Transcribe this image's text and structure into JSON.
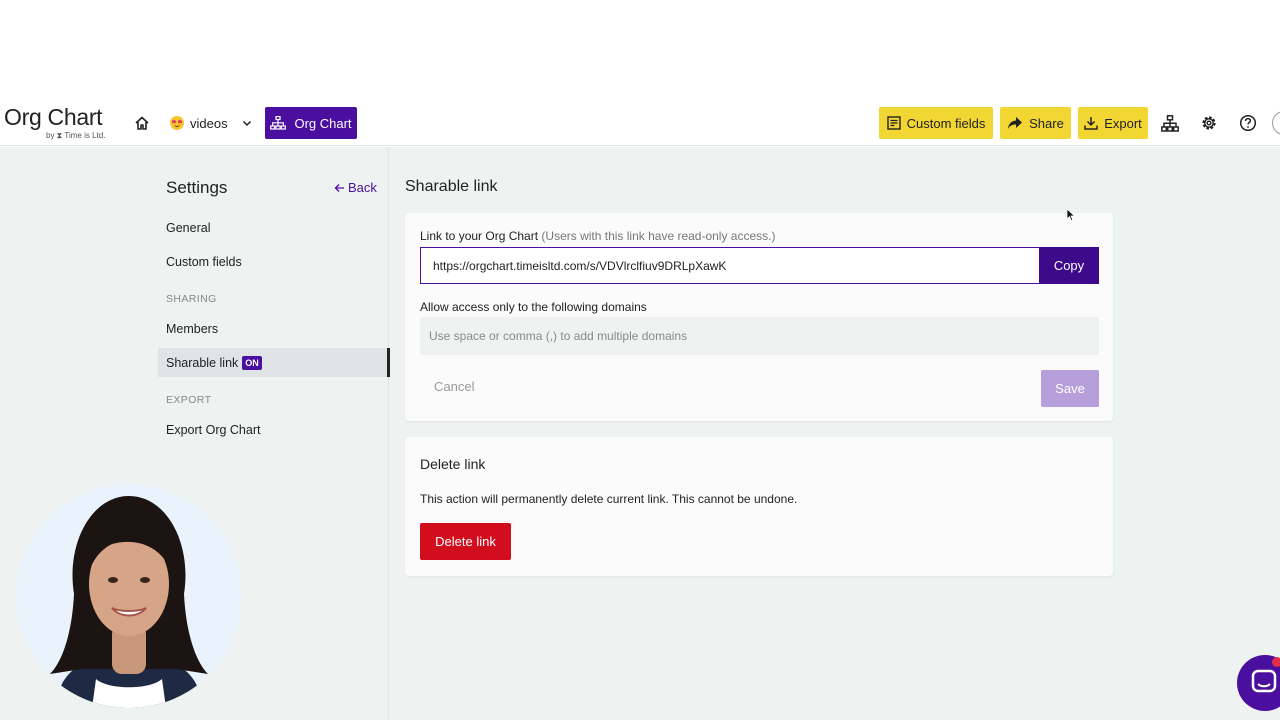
{
  "app": {
    "logo_title": "Org Chart",
    "logo_subtitle": "by ⧗ Time is Ltd."
  },
  "navbar": {
    "workspace_label": "videos",
    "org_chart_label": "Org Chart",
    "custom_fields_label": "Custom fields",
    "share_label": "Share",
    "export_label": "Export"
  },
  "sidebar": {
    "title": "Settings",
    "back_label": "Back",
    "items": [
      {
        "label": "General"
      },
      {
        "label": "Custom fields"
      },
      {
        "section": "SHARING"
      },
      {
        "label": "Members"
      },
      {
        "label": "Sharable link",
        "badge": "ON"
      },
      {
        "section": "EXPORT"
      },
      {
        "label": "Export Org Chart"
      }
    ]
  },
  "content": {
    "title": "Sharable link",
    "link_label": "Link to your Org Chart",
    "link_hint": "(Users with this link have read-only access.)",
    "link_value": "https://orgchart.timeisltd.com/s/VDVlrclfiuv9DRLpXawK",
    "copy_label": "Copy",
    "domains_label": "Allow access only to the following domains",
    "domains_placeholder": "Use space or comma (,) to add multiple domains",
    "cancel_label": "Cancel",
    "save_label": "Save",
    "delete_title": "Delete link",
    "delete_text": "This action will permanently delete current link. This cannot be undone.",
    "delete_button": "Delete link"
  },
  "colors": {
    "brand_purple": "#4b0fa0",
    "action_yellow": "#f2d634",
    "danger_red": "#d10d1e",
    "save_disabled": "#b79fdb"
  }
}
